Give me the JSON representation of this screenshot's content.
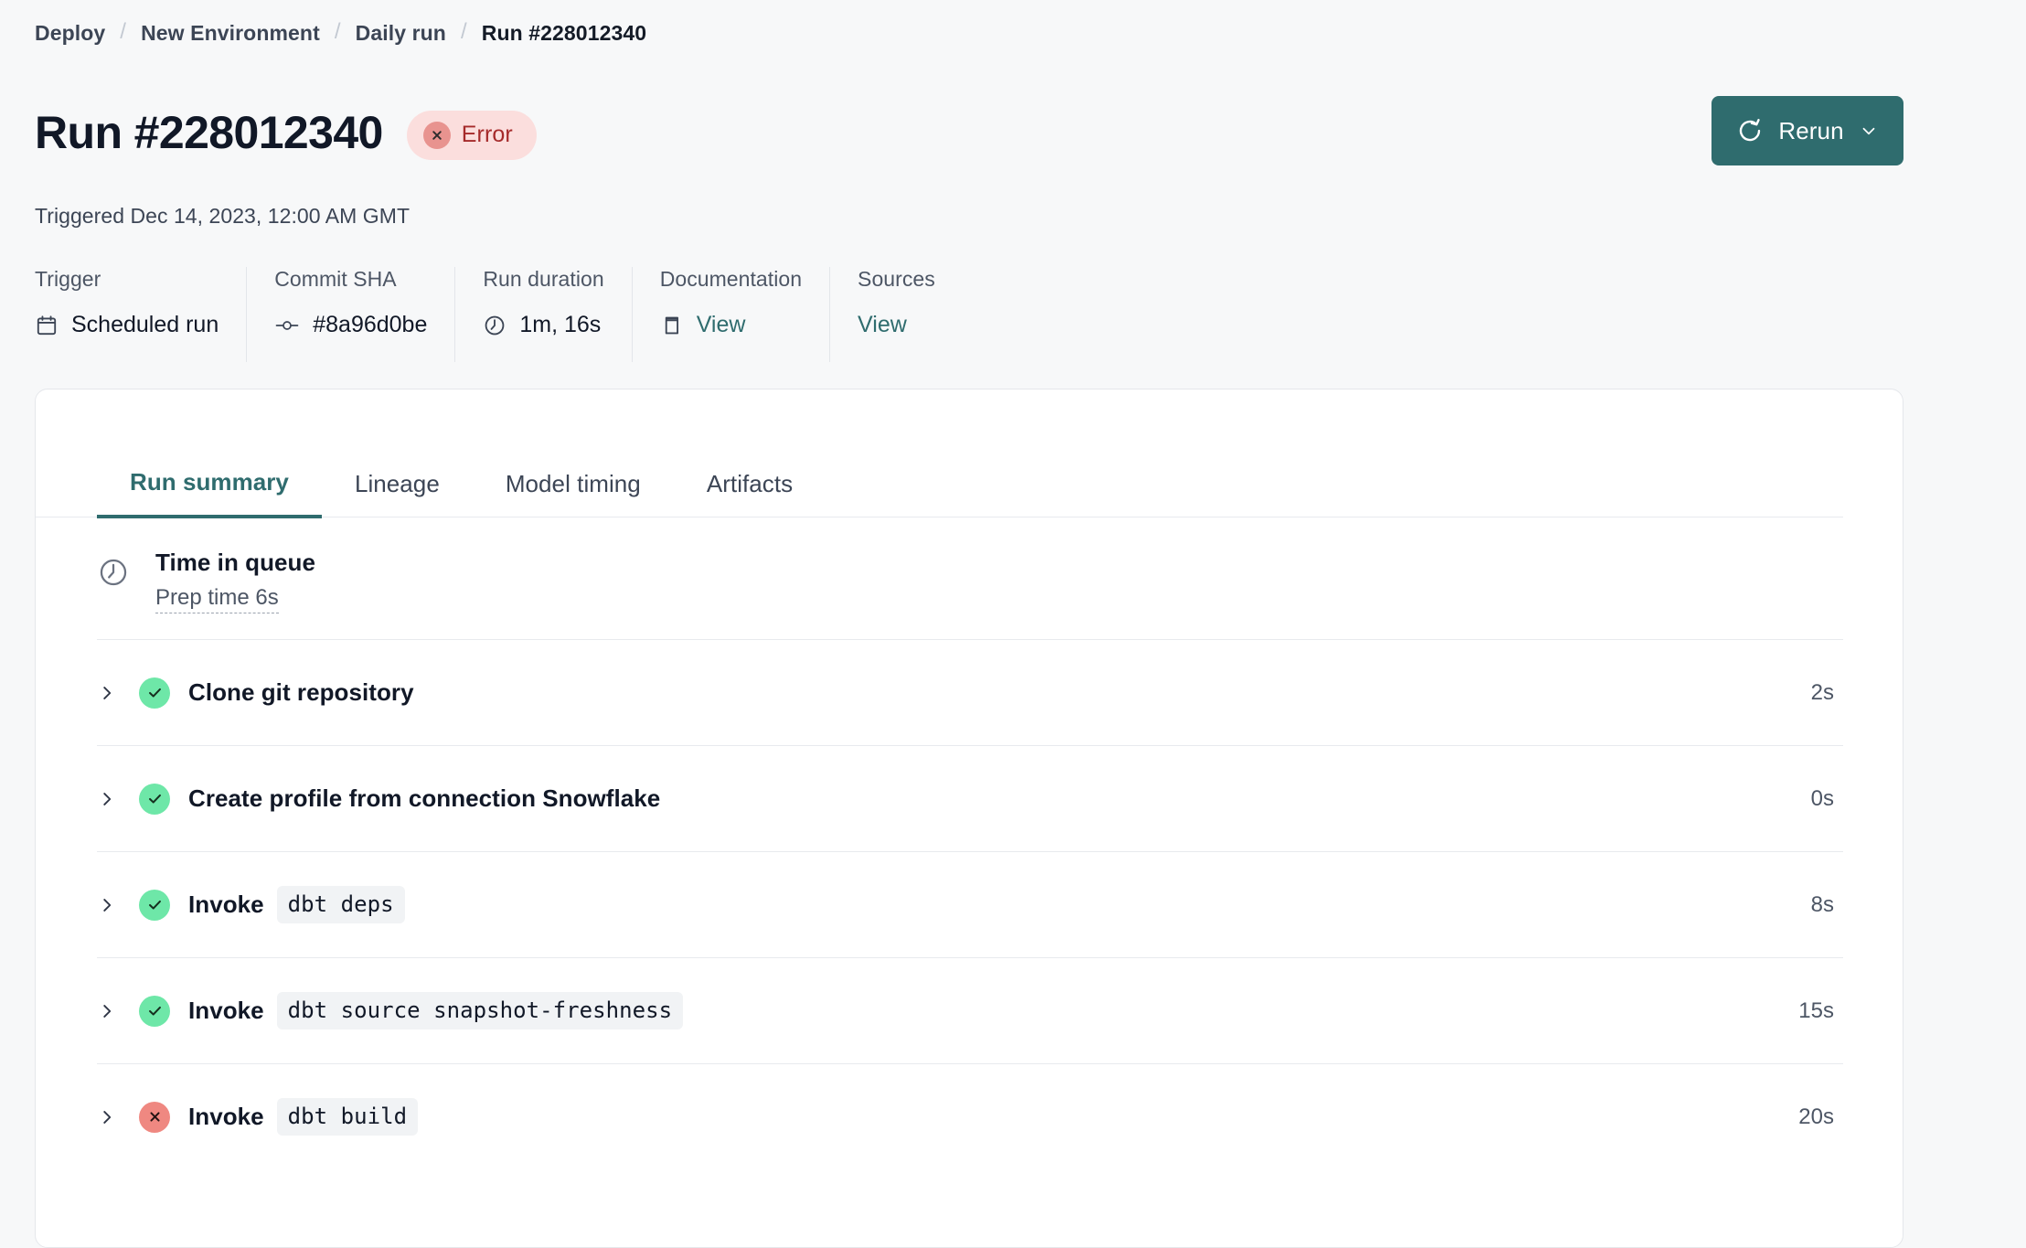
{
  "breadcrumb": {
    "separator": "/",
    "items": [
      {
        "label": "Deploy",
        "current": false
      },
      {
        "label": "New Environment",
        "current": false
      },
      {
        "label": "Daily run",
        "current": false
      },
      {
        "label": "Run #228012340",
        "current": true
      }
    ]
  },
  "header": {
    "title": "Run #228012340",
    "status": {
      "label": "Error",
      "icon": "x-circle-icon",
      "bg": "#fbdedd",
      "fg": "#a52a2a",
      "dot": "#e8938f"
    },
    "subtitle": "Triggered Dec 14, 2023, 12:00 AM GMT",
    "rerun": {
      "label": "Rerun",
      "icon": "refresh-icon",
      "caret": "chevron-down-icon",
      "color": "#2f6c6e"
    }
  },
  "meta": [
    {
      "label": "Trigger",
      "value": "Scheduled run",
      "icon": "calendar-icon",
      "link": false
    },
    {
      "label": "Commit SHA",
      "value": "#8a96d0be",
      "icon": "commit-icon",
      "link": false
    },
    {
      "label": "Run duration",
      "value": "1m, 16s",
      "icon": "clock-icon",
      "link": false
    },
    {
      "label": "Documentation",
      "value": "View",
      "icon": "book-icon",
      "link": true
    },
    {
      "label": "Sources",
      "value": "View",
      "icon": "none",
      "link": true
    }
  ],
  "tabs": [
    {
      "label": "Run summary",
      "active": true
    },
    {
      "label": "Lineage",
      "active": false
    },
    {
      "label": "Model timing",
      "active": false
    },
    {
      "label": "Artifacts",
      "active": false
    }
  ],
  "queue": {
    "icon": "clock-icon",
    "title": "Time in queue",
    "prep": "Prep time 6s"
  },
  "steps": [
    {
      "status": "success",
      "name": "Clone git repository",
      "code": "",
      "duration": "2s"
    },
    {
      "status": "success",
      "name": "Create profile from connection Snowflake",
      "code": "",
      "duration": "0s"
    },
    {
      "status": "success",
      "name": "Invoke",
      "code": "dbt deps",
      "duration": "8s"
    },
    {
      "status": "success",
      "name": "Invoke",
      "code": "dbt source snapshot-freshness",
      "duration": "15s"
    },
    {
      "status": "error",
      "name": "Invoke",
      "code": "dbt build",
      "duration": "20s"
    }
  ]
}
